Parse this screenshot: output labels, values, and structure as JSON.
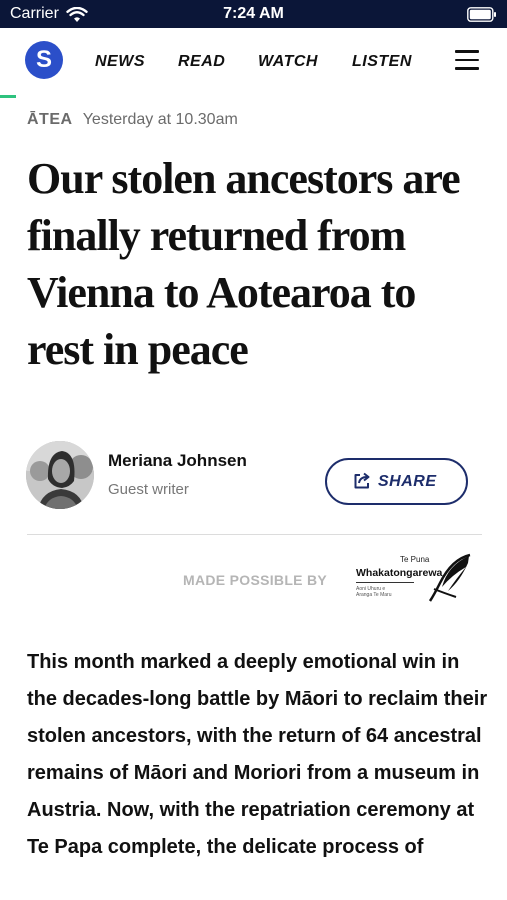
{
  "status_bar": {
    "carrier": "Carrier",
    "time": "7:24 AM",
    "background": "#0b1638"
  },
  "nav": {
    "logo_letter": "S",
    "logo_color": "#2b4fc9",
    "items": [
      "NEWS",
      "READ",
      "WATCH",
      "LISTEN"
    ],
    "menu_icon": "hamburger-icon"
  },
  "article": {
    "section": "ĀTEA",
    "timestamp": "Yesterday at 10.30am",
    "headline": "Our stolen ancestors are finally returned from Vienna to Aotearoa to rest in peace",
    "author": {
      "name": "Meriana Johnsen",
      "role": "Guest writer"
    },
    "share_label": "SHARE",
    "sponsor": {
      "label": "MADE POSSIBLE BY",
      "logo_top": "Te Puna",
      "logo_name": "Whakatongarewa",
      "logo_small_text": "Aoni Uhuru e Aranga Te Maru"
    },
    "body": "This month marked a deeply emotional win in the decades-long battle by Māori to reclaim their stolen ancestors, with the return of 64 ancestral remains of Māori and Moriori from a museum in Austria. Now, with the repatriation ceremony at Te Papa complete, the delicate process of"
  }
}
